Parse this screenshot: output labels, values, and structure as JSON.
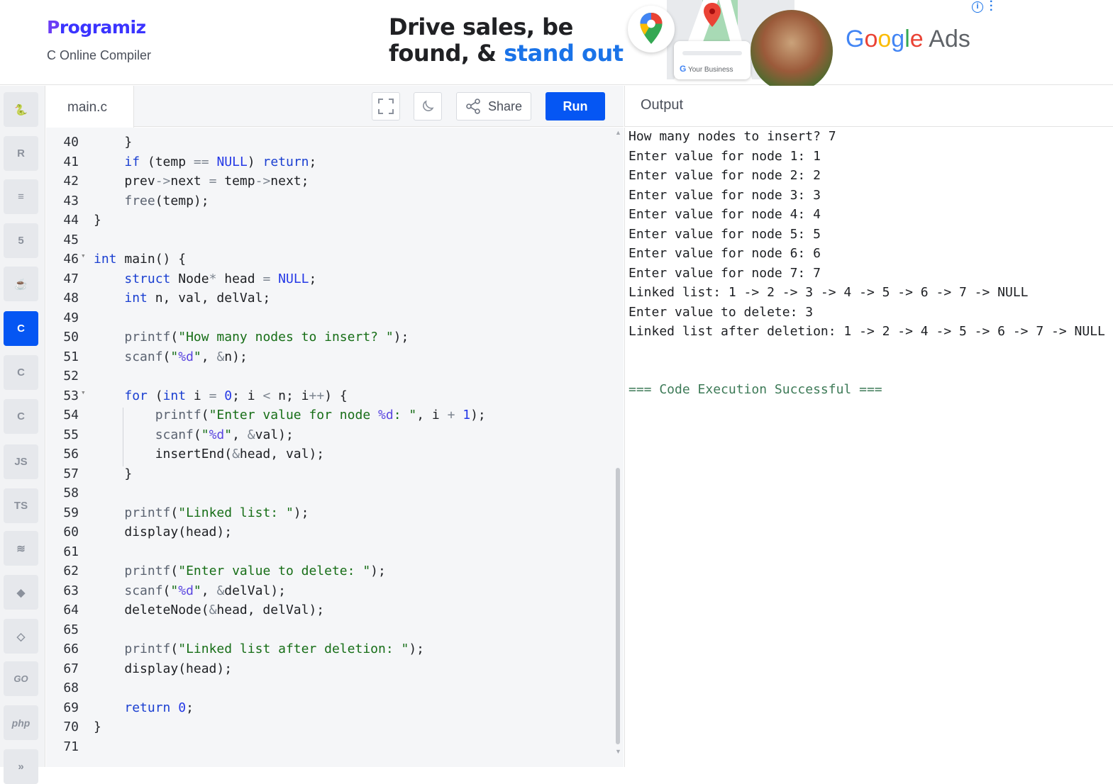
{
  "header": {
    "logo_text": "rogramiz",
    "logo_initial": "P",
    "subtitle": "C Online Compiler"
  },
  "ad": {
    "line1": "Drive sales, be",
    "line2_a": "found, & ",
    "line2_b": "stand out",
    "card_label": "Your Business",
    "brand_g": "G",
    "brand_o1": "o",
    "brand_o2": "o",
    "brand_g2": "g",
    "brand_l": "l",
    "brand_e": "e",
    "brand_ads": " Ads",
    "info": "i"
  },
  "sidebar": {
    "languages": [
      {
        "name": "python",
        "glyph": "🐍"
      },
      {
        "name": "r",
        "glyph": "R"
      },
      {
        "name": "sql",
        "glyph": "≡"
      },
      {
        "name": "html",
        "glyph": "5"
      },
      {
        "name": "java",
        "glyph": "☕"
      },
      {
        "name": "c",
        "glyph": "C",
        "active": true
      },
      {
        "name": "cpp",
        "glyph": "C"
      },
      {
        "name": "csharp",
        "glyph": "C"
      },
      {
        "name": "js",
        "glyph": "JS"
      },
      {
        "name": "ts",
        "glyph": "TS"
      },
      {
        "name": "swift",
        "glyph": "≋"
      },
      {
        "name": "dart",
        "glyph": "◆"
      },
      {
        "name": "rust",
        "glyph": "◇"
      },
      {
        "name": "go",
        "glyph": "GO"
      },
      {
        "name": "php",
        "glyph": "php"
      },
      {
        "name": "kotlin",
        "glyph": "»"
      }
    ]
  },
  "editor": {
    "tab_name": "main.c",
    "share_label": "Share",
    "run_label": "Run",
    "lines": [
      {
        "n": "40",
        "html": "    }"
      },
      {
        "n": "41",
        "html": "    <span class='kw'>if</span> (temp <span class='op'>==</span> <span class='num'>NULL</span>) <span class='kw'>return</span>;"
      },
      {
        "n": "42",
        "html": "    prev<span class='op'>-&gt;</span>next <span class='op'>=</span> temp<span class='op'>-&gt;</span>next;"
      },
      {
        "n": "43",
        "html": "    <span class='fn'>free</span>(temp);"
      },
      {
        "n": "44",
        "html": "}"
      },
      {
        "n": "45",
        "html": ""
      },
      {
        "n": "46",
        "html": "<span class='kw'>int</span> main() {",
        "fold": true
      },
      {
        "n": "47",
        "html": "    <span class='kw'>struct</span> Node<span class='op'>*</span> head <span class='op'>=</span> <span class='num'>NULL</span>;"
      },
      {
        "n": "48",
        "html": "    <span class='kw'>int</span> n, val, delVal;"
      },
      {
        "n": "49",
        "html": ""
      },
      {
        "n": "50",
        "html": "    <span class='fn'>printf</span>(<span class='str'>\"How many nodes to insert? \"</span>);"
      },
      {
        "n": "51",
        "html": "    <span class='fn'>scanf</span>(<span class='str'>\"<span class='fmt'>%d</span>\"</span>, <span class='op'>&amp;</span>n);"
      },
      {
        "n": "52",
        "html": ""
      },
      {
        "n": "53",
        "html": "    <span class='kw'>for</span> (<span class='kw'>int</span> i <span class='op'>=</span> <span class='num'>0</span>; i <span class='op'>&lt;</span> n; i<span class='op'>++</span>) {",
        "fold": true
      },
      {
        "n": "54",
        "html": "        <span class='fn'>printf</span>(<span class='str'>\"Enter value for node <span class='fmt'>%d</span>: \"</span>, i <span class='op'>+</span> <span class='num'>1</span>);"
      },
      {
        "n": "55",
        "html": "        <span class='fn'>scanf</span>(<span class='str'>\"<span class='fmt'>%d</span>\"</span>, <span class='op'>&amp;</span>val);"
      },
      {
        "n": "56",
        "html": "        insertEnd(<span class='op'>&amp;</span>head, val);"
      },
      {
        "n": "57",
        "html": "    }"
      },
      {
        "n": "58",
        "html": ""
      },
      {
        "n": "59",
        "html": "    <span class='fn'>printf</span>(<span class='str'>\"Linked list: \"</span>);"
      },
      {
        "n": "60",
        "html": "    display(head);"
      },
      {
        "n": "61",
        "html": ""
      },
      {
        "n": "62",
        "html": "    <span class='fn'>printf</span>(<span class='str'>\"Enter value to delete: \"</span>);"
      },
      {
        "n": "63",
        "html": "    <span class='fn'>scanf</span>(<span class='str'>\"<span class='fmt'>%d</span>\"</span>, <span class='op'>&amp;</span>delVal);"
      },
      {
        "n": "64",
        "html": "    deleteNode(<span class='op'>&amp;</span>head, delVal);"
      },
      {
        "n": "65",
        "html": ""
      },
      {
        "n": "66",
        "html": "    <span class='fn'>printf</span>(<span class='str'>\"Linked list after deletion: \"</span>);"
      },
      {
        "n": "67",
        "html": "    display(head);"
      },
      {
        "n": "68",
        "html": ""
      },
      {
        "n": "69",
        "html": "    <span class='kw'>return</span> <span class='num'>0</span>;"
      },
      {
        "n": "70",
        "html": "}"
      },
      {
        "n": "71",
        "html": ""
      }
    ]
  },
  "output": {
    "title": "Output",
    "lines": [
      "How many nodes to insert? 7",
      "Enter value for node 1: 1",
      "Enter value for node 2: 2",
      "Enter value for node 3: 3",
      "Enter value for node 4: 4",
      "Enter value for node 5: 5",
      "Enter value for node 6: 6",
      "Enter value for node 7: 7",
      "Linked list: 1 -> 2 -> 3 -> 4 -> 5 -> 6 -> 7 -> NULL",
      "Enter value to delete: 3",
      "Linked list after deletion: 1 -> 2 -> 4 -> 5 -> 6 -> 7 -> NULL"
    ],
    "success": "=== Code Execution Successful ==="
  },
  "colors": {
    "accent": "#0556f3",
    "keyword": "#1a3fd1",
    "string": "#176e17",
    "success": "#3d7a57"
  }
}
